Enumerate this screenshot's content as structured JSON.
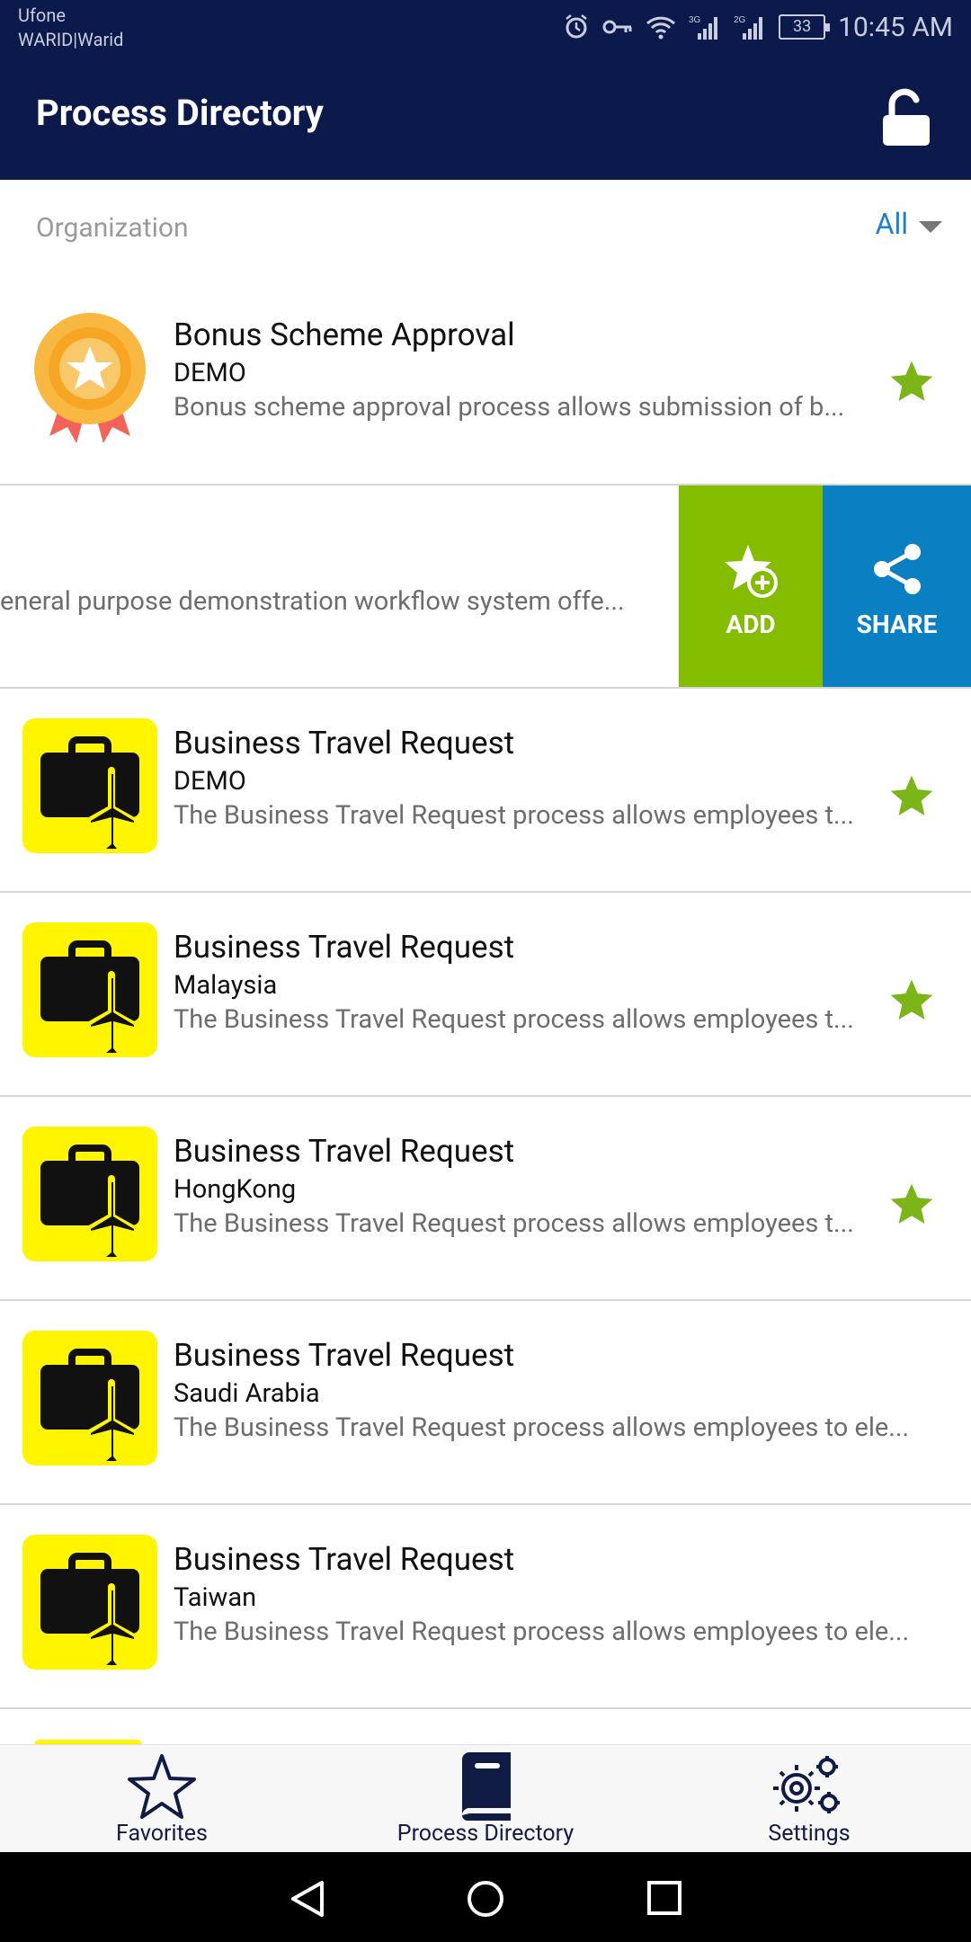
{
  "status_bar": {
    "carrier_1": "Ufone",
    "carrier_2": "WARID|Warid",
    "battery": "33",
    "time": "10:45 AM",
    "network_1": "3G",
    "network_2": "2G"
  },
  "app_bar": {
    "title": "Process Directory",
    "lock_icon": "unlock-icon"
  },
  "filter": {
    "label": "Organization",
    "value": "All"
  },
  "items": [
    {
      "title": "Bonus Scheme Approval",
      "subtitle": "DEMO",
      "description": "Bonus scheme approval process allows submission of b...",
      "icon": "award-badge-icon",
      "favorite": true
    },
    {
      "title": "",
      "subtitle": "",
      "description": "eneral purpose demonstration workflow system offe...",
      "swiped": true
    },
    {
      "title": "Business Travel Request",
      "subtitle": "DEMO",
      "description": "The Business Travel Request process allows employees t...",
      "icon": "travel-icon",
      "favorite": true
    },
    {
      "title": "Business Travel Request",
      "subtitle": "Malaysia",
      "description": "The Business Travel Request process allows employees t...",
      "icon": "travel-icon",
      "favorite": true
    },
    {
      "title": "Business Travel Request",
      "subtitle": "HongKong",
      "description": "The Business Travel Request process allows employees t...",
      "icon": "travel-icon",
      "favorite": true
    },
    {
      "title": "Business Travel Request",
      "subtitle": "Saudi Arabia",
      "description": "The Business Travel Request process allows employees to ele...",
      "icon": "travel-icon",
      "favorite": false
    },
    {
      "title": "Business Travel Request",
      "subtitle": "Taiwan",
      "description": "The Business Travel Request process allows employees to ele...",
      "icon": "travel-icon",
      "favorite": false
    }
  ],
  "swipe_actions": {
    "add_label": "ADD",
    "share_label": "SHARE",
    "add_color": "#84bd00",
    "share_color": "#0a7fc2"
  },
  "bottom_nav": [
    {
      "label": "Favorites",
      "icon": "star-outline-icon"
    },
    {
      "label": "Process Directory",
      "icon": "book-icon"
    },
    {
      "label": "Settings",
      "icon": "gears-icon"
    }
  ],
  "colors": {
    "primary": "#0b1a4a",
    "accent": "#1d7fd1",
    "star": "#7cb518"
  }
}
